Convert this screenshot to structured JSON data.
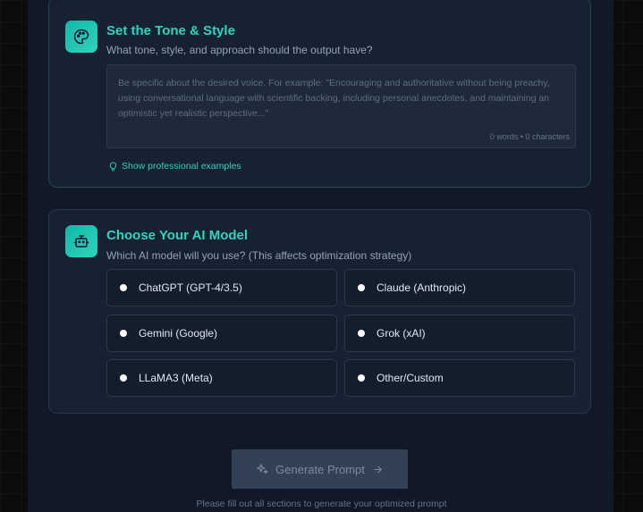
{
  "tone": {
    "title": "Set the Tone & Style",
    "subtitle": "What tone, style, and approach should the output have?",
    "placeholder": "Be specific about the desired voice. For example: \"Encouraging and authoritative without being preachy, using conversational language with scientific backing, including personal anecdotes, and maintaining an optimistic yet realistic perspective...\"",
    "counter": "0 words • 0 characters",
    "examples_link": "Show professional examples",
    "icon": "palette-icon"
  },
  "model": {
    "title": "Choose Your AI Model",
    "subtitle": "Which AI model will you use? (This affects optimization strategy)",
    "icon": "robot-icon",
    "options": [
      {
        "label": "ChatGPT (GPT-4/3.5)"
      },
      {
        "label": "Claude (Anthropic)"
      },
      {
        "label": "Gemini (Google)"
      },
      {
        "label": "Grok (xAI)"
      },
      {
        "label": "LLaMA3 (Meta)"
      },
      {
        "label": "Other/Custom"
      }
    ]
  },
  "generate": {
    "label": "Generate Prompt",
    "hint": "Please fill out all sections to generate your optimized prompt"
  },
  "colors": {
    "accent": "#2dd4bf",
    "card_bg": "#162131",
    "button_disabled": "#334155"
  }
}
